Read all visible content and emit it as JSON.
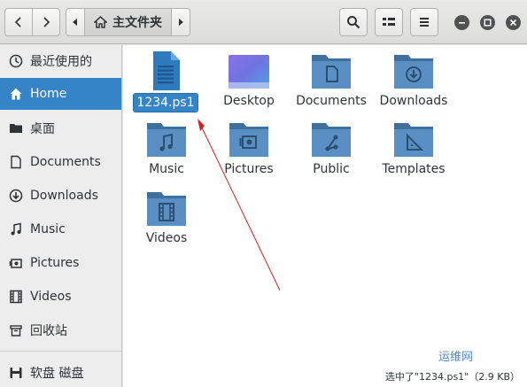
{
  "header": {
    "back_icon": "chevron-left-icon",
    "forward_icon": "chevron-right-icon",
    "path_left_icon": "pan-left-icon",
    "path_right_icon": "pan-right-icon",
    "current_folder": "主文件夹",
    "current_folder_icon": "home-icon",
    "search_icon": "search-icon",
    "view_icon": "view-list-icon",
    "menu_icon": "hamburger-menu-icon",
    "window_controls": [
      "minimize-icon",
      "maximize-icon",
      "close-icon"
    ]
  },
  "sidebar": {
    "items": [
      {
        "label": "最近使用的",
        "icon": "recent-icon",
        "active": false
      },
      {
        "label": "Home",
        "icon": "home-icon",
        "active": true
      },
      {
        "label": "桌面",
        "icon": "desktop-folder-icon",
        "active": false
      },
      {
        "label": "Documents",
        "icon": "document-icon",
        "active": false
      },
      {
        "label": "Downloads",
        "icon": "download-icon",
        "active": false
      },
      {
        "label": "Music",
        "icon": "music-icon",
        "active": false
      },
      {
        "label": "Pictures",
        "icon": "picture-icon",
        "active": false
      },
      {
        "label": "Videos",
        "icon": "video-icon",
        "active": false
      },
      {
        "label": "回收站",
        "icon": "trash-icon",
        "active": false
      },
      {
        "label": "软盘 磁盘",
        "icon": "floppy-icon",
        "active": false
      }
    ]
  },
  "files": [
    {
      "name": "1234.ps1",
      "type": "text-file",
      "selected": true
    },
    {
      "name": "Desktop",
      "type": "desktop-folder",
      "selected": false
    },
    {
      "name": "Documents",
      "type": "documents-folder",
      "selected": false
    },
    {
      "name": "Downloads",
      "type": "downloads-folder",
      "selected": false
    },
    {
      "name": "Music",
      "type": "music-folder",
      "selected": false
    },
    {
      "name": "Pictures",
      "type": "pictures-folder",
      "selected": false
    },
    {
      "name": "Public",
      "type": "public-folder",
      "selected": false
    },
    {
      "name": "Templates",
      "type": "templates-folder",
      "selected": false
    },
    {
      "name": "Videos",
      "type": "videos-folder",
      "selected": false
    }
  ],
  "status": "选中了\"1234.ps1\"（2.9 KB）",
  "watermark": "运维网",
  "colors": {
    "accent": "#3584c7",
    "folder": "#5a8fc4",
    "annotation_arrow": "#cc2222"
  }
}
